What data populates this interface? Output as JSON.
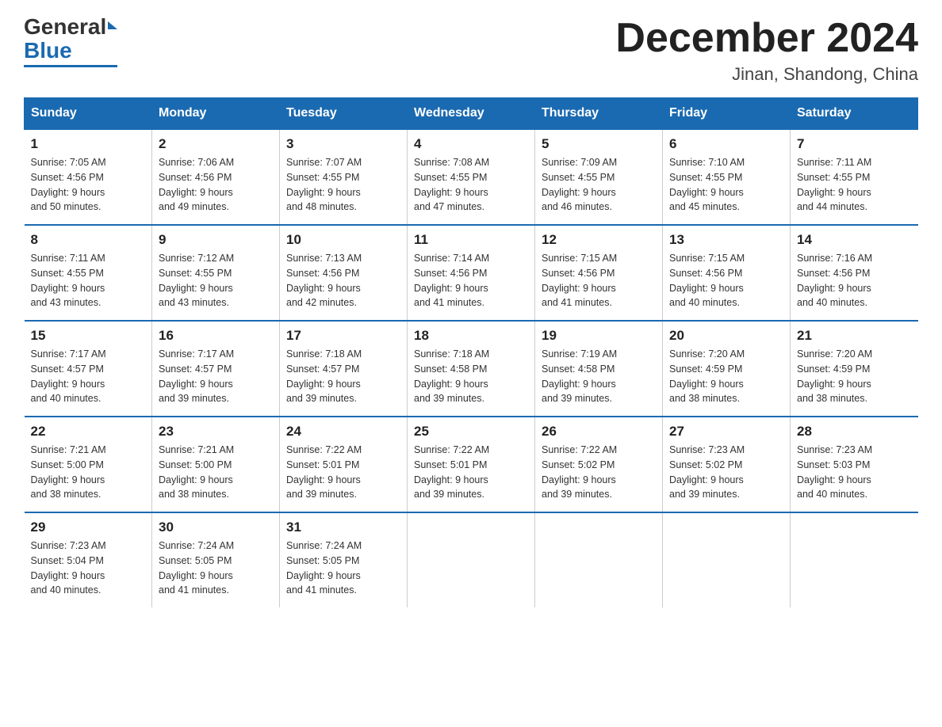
{
  "logo": {
    "general": "General",
    "blue": "Blue"
  },
  "title": "December 2024",
  "location": "Jinan, Shandong, China",
  "weekdays": [
    "Sunday",
    "Monday",
    "Tuesday",
    "Wednesday",
    "Thursday",
    "Friday",
    "Saturday"
  ],
  "weeks": [
    [
      {
        "day": "1",
        "sunrise": "7:05 AM",
        "sunset": "4:56 PM",
        "daylight": "9 hours and 50 minutes."
      },
      {
        "day": "2",
        "sunrise": "7:06 AM",
        "sunset": "4:56 PM",
        "daylight": "9 hours and 49 minutes."
      },
      {
        "day": "3",
        "sunrise": "7:07 AM",
        "sunset": "4:55 PM",
        "daylight": "9 hours and 48 minutes."
      },
      {
        "day": "4",
        "sunrise": "7:08 AM",
        "sunset": "4:55 PM",
        "daylight": "9 hours and 47 minutes."
      },
      {
        "day": "5",
        "sunrise": "7:09 AM",
        "sunset": "4:55 PM",
        "daylight": "9 hours and 46 minutes."
      },
      {
        "day": "6",
        "sunrise": "7:10 AM",
        "sunset": "4:55 PM",
        "daylight": "9 hours and 45 minutes."
      },
      {
        "day": "7",
        "sunrise": "7:11 AM",
        "sunset": "4:55 PM",
        "daylight": "9 hours and 44 minutes."
      }
    ],
    [
      {
        "day": "8",
        "sunrise": "7:11 AM",
        "sunset": "4:55 PM",
        "daylight": "9 hours and 43 minutes."
      },
      {
        "day": "9",
        "sunrise": "7:12 AM",
        "sunset": "4:55 PM",
        "daylight": "9 hours and 43 minutes."
      },
      {
        "day": "10",
        "sunrise": "7:13 AM",
        "sunset": "4:56 PM",
        "daylight": "9 hours and 42 minutes."
      },
      {
        "day": "11",
        "sunrise": "7:14 AM",
        "sunset": "4:56 PM",
        "daylight": "9 hours and 41 minutes."
      },
      {
        "day": "12",
        "sunrise": "7:15 AM",
        "sunset": "4:56 PM",
        "daylight": "9 hours and 41 minutes."
      },
      {
        "day": "13",
        "sunrise": "7:15 AM",
        "sunset": "4:56 PM",
        "daylight": "9 hours and 40 minutes."
      },
      {
        "day": "14",
        "sunrise": "7:16 AM",
        "sunset": "4:56 PM",
        "daylight": "9 hours and 40 minutes."
      }
    ],
    [
      {
        "day": "15",
        "sunrise": "7:17 AM",
        "sunset": "4:57 PM",
        "daylight": "9 hours and 40 minutes."
      },
      {
        "day": "16",
        "sunrise": "7:17 AM",
        "sunset": "4:57 PM",
        "daylight": "9 hours and 39 minutes."
      },
      {
        "day": "17",
        "sunrise": "7:18 AM",
        "sunset": "4:57 PM",
        "daylight": "9 hours and 39 minutes."
      },
      {
        "day": "18",
        "sunrise": "7:18 AM",
        "sunset": "4:58 PM",
        "daylight": "9 hours and 39 minutes."
      },
      {
        "day": "19",
        "sunrise": "7:19 AM",
        "sunset": "4:58 PM",
        "daylight": "9 hours and 39 minutes."
      },
      {
        "day": "20",
        "sunrise": "7:20 AM",
        "sunset": "4:59 PM",
        "daylight": "9 hours and 38 minutes."
      },
      {
        "day": "21",
        "sunrise": "7:20 AM",
        "sunset": "4:59 PM",
        "daylight": "9 hours and 38 minutes."
      }
    ],
    [
      {
        "day": "22",
        "sunrise": "7:21 AM",
        "sunset": "5:00 PM",
        "daylight": "9 hours and 38 minutes."
      },
      {
        "day": "23",
        "sunrise": "7:21 AM",
        "sunset": "5:00 PM",
        "daylight": "9 hours and 38 minutes."
      },
      {
        "day": "24",
        "sunrise": "7:22 AM",
        "sunset": "5:01 PM",
        "daylight": "9 hours and 39 minutes."
      },
      {
        "day": "25",
        "sunrise": "7:22 AM",
        "sunset": "5:01 PM",
        "daylight": "9 hours and 39 minutes."
      },
      {
        "day": "26",
        "sunrise": "7:22 AM",
        "sunset": "5:02 PM",
        "daylight": "9 hours and 39 minutes."
      },
      {
        "day": "27",
        "sunrise": "7:23 AM",
        "sunset": "5:02 PM",
        "daylight": "9 hours and 39 minutes."
      },
      {
        "day": "28",
        "sunrise": "7:23 AM",
        "sunset": "5:03 PM",
        "daylight": "9 hours and 40 minutes."
      }
    ],
    [
      {
        "day": "29",
        "sunrise": "7:23 AM",
        "sunset": "5:04 PM",
        "daylight": "9 hours and 40 minutes."
      },
      {
        "day": "30",
        "sunrise": "7:24 AM",
        "sunset": "5:05 PM",
        "daylight": "9 hours and 41 minutes."
      },
      {
        "day": "31",
        "sunrise": "7:24 AM",
        "sunset": "5:05 PM",
        "daylight": "9 hours and 41 minutes."
      },
      null,
      null,
      null,
      null
    ]
  ],
  "labels": {
    "sunrise": "Sunrise:",
    "sunset": "Sunset:",
    "daylight": "Daylight:"
  }
}
